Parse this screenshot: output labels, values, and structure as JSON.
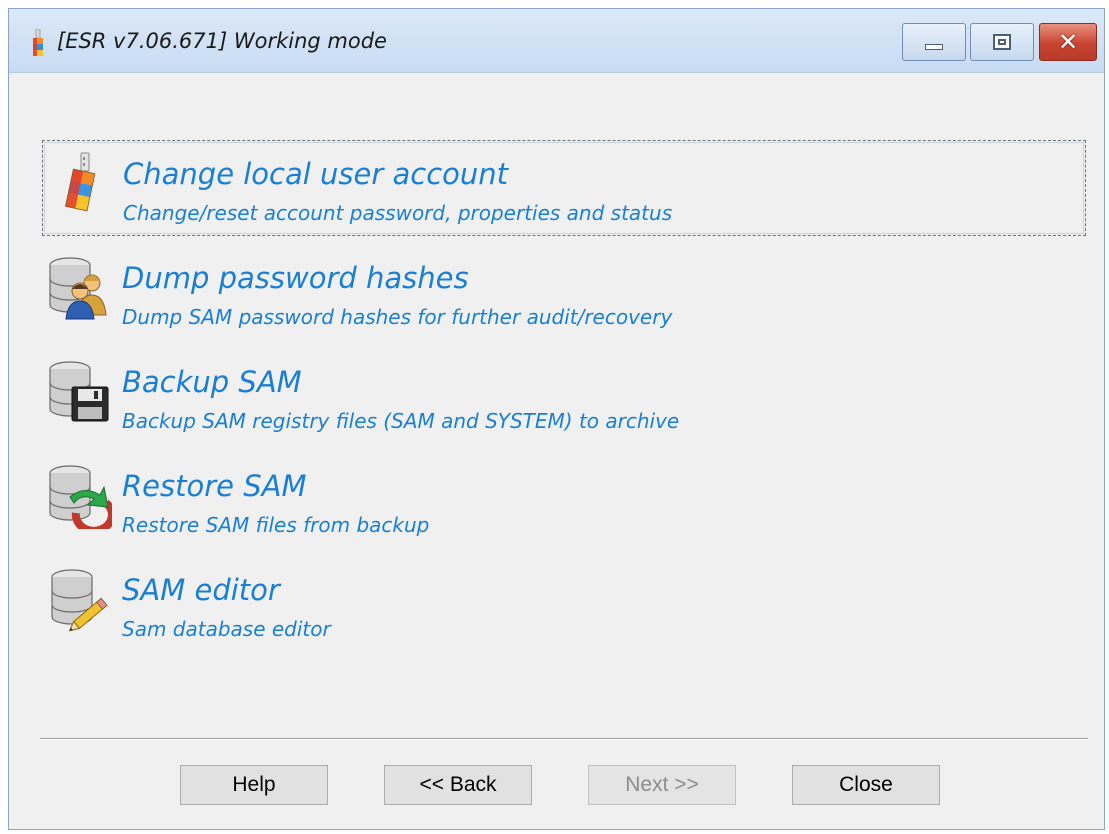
{
  "window": {
    "title": "[ESR v7.06.671]  Working mode",
    "controls": {
      "minimize_icon": "minimize-icon",
      "maximize_icon": "maximize-icon",
      "close_symbol": "✕"
    }
  },
  "items": [
    {
      "title": "Change local user account",
      "description": "Change/reset account password, properties and status",
      "icon": "usb-key-icon",
      "selected": true
    },
    {
      "title": "Dump password hashes",
      "description": "Dump SAM password hashes for further audit/recovery",
      "icon": "database-users-icon",
      "selected": false
    },
    {
      "title": "Backup SAM",
      "description": "Backup SAM registry files (SAM and SYSTEM) to archive",
      "icon": "database-floppy-icon",
      "selected": false
    },
    {
      "title": "Restore SAM",
      "description": "Restore SAM files from backup",
      "icon": "database-restore-icon",
      "selected": false
    },
    {
      "title": "SAM editor",
      "description": "Sam database editor",
      "icon": "database-pencil-icon",
      "selected": false
    }
  ],
  "buttons": {
    "help": "Help",
    "back": "<< Back",
    "next": "Next >>",
    "close": "Close"
  },
  "colors": {
    "link_text": "#1a7fd4",
    "window_bg": "#f0f0f0",
    "close_button": "#c84431"
  }
}
